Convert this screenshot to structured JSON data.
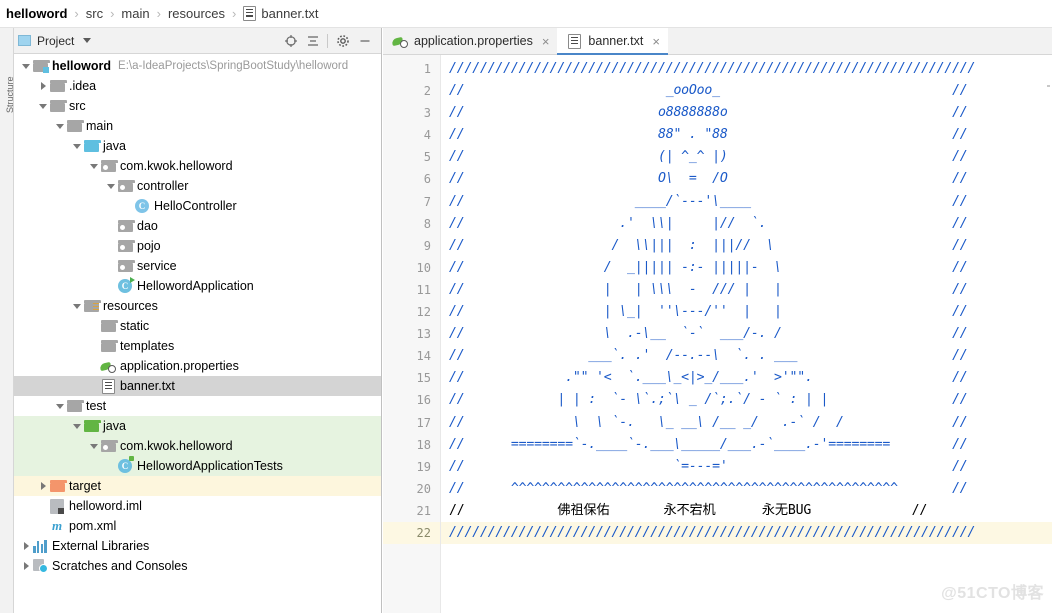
{
  "breadcrumb": {
    "items": [
      "helloword",
      "src",
      "main",
      "resources",
      "banner.txt"
    ],
    "separator": "›",
    "file_icon": "text-file-icon"
  },
  "left_strip": {
    "label": "Structure"
  },
  "project_panel": {
    "title": "Project",
    "caret_icon": "chevron-down-icon",
    "tools": [
      {
        "name": "locate-icon",
        "glyph": "⊕"
      },
      {
        "name": "collapse-all-icon",
        "glyph": "≡"
      },
      {
        "name": "settings-gear-icon",
        "glyph": "⚙"
      },
      {
        "name": "hide-panel-icon",
        "glyph": "—"
      }
    ],
    "tree": [
      {
        "label": "helloword",
        "hint": "E:\\a-IdeaProjects\\SpringBootStudy\\helloword",
        "indent": 0,
        "arrow": "open",
        "icon": "module-folder",
        "bold": true,
        "state": ""
      },
      {
        "label": ".idea",
        "hint": "",
        "indent": 1,
        "arrow": "closed",
        "icon": "folder-grey",
        "bold": false,
        "state": ""
      },
      {
        "label": "src",
        "hint": "",
        "indent": 1,
        "arrow": "open",
        "icon": "folder-grey",
        "bold": false,
        "state": ""
      },
      {
        "label": "main",
        "hint": "",
        "indent": 2,
        "arrow": "open",
        "icon": "folder-grey",
        "bold": false,
        "state": ""
      },
      {
        "label": "java",
        "hint": "",
        "indent": 3,
        "arrow": "open",
        "icon": "folder-blue",
        "bold": false,
        "state": ""
      },
      {
        "label": "com.kwok.helloword",
        "hint": "",
        "indent": 4,
        "arrow": "open",
        "icon": "package",
        "bold": false,
        "state": ""
      },
      {
        "label": "controller",
        "hint": "",
        "indent": 5,
        "arrow": "open",
        "icon": "package",
        "bold": false,
        "state": ""
      },
      {
        "label": "HelloController",
        "hint": "",
        "indent": 6,
        "arrow": "none",
        "icon": "class",
        "bold": false,
        "state": ""
      },
      {
        "label": "dao",
        "hint": "",
        "indent": 5,
        "arrow": "none",
        "icon": "package",
        "bold": false,
        "state": ""
      },
      {
        "label": "pojo",
        "hint": "",
        "indent": 5,
        "arrow": "none",
        "icon": "package",
        "bold": false,
        "state": ""
      },
      {
        "label": "service",
        "hint": "",
        "indent": 5,
        "arrow": "none",
        "icon": "package",
        "bold": false,
        "state": ""
      },
      {
        "label": "HellowordApplication",
        "hint": "",
        "indent": 5,
        "arrow": "none",
        "icon": "class-run",
        "bold": false,
        "state": ""
      },
      {
        "label": "resources",
        "hint": "",
        "indent": 3,
        "arrow": "open",
        "icon": "folder-resources",
        "bold": false,
        "state": ""
      },
      {
        "label": "static",
        "hint": "",
        "indent": 4,
        "arrow": "none",
        "icon": "folder-grey",
        "bold": false,
        "state": ""
      },
      {
        "label": "templates",
        "hint": "",
        "indent": 4,
        "arrow": "none",
        "icon": "folder-grey",
        "bold": false,
        "state": ""
      },
      {
        "label": "application.properties",
        "hint": "",
        "indent": 4,
        "arrow": "none",
        "icon": "properties",
        "bold": false,
        "state": ""
      },
      {
        "label": "banner.txt",
        "hint": "",
        "indent": 4,
        "arrow": "none",
        "icon": "text-file",
        "bold": false,
        "state": "sel"
      },
      {
        "label": "test",
        "hint": "",
        "indent": 2,
        "arrow": "open",
        "icon": "folder-grey",
        "bold": false,
        "state": ""
      },
      {
        "label": "java",
        "hint": "",
        "indent": 3,
        "arrow": "open",
        "icon": "folder-green",
        "bold": false,
        "state": "green"
      },
      {
        "label": "com.kwok.helloword",
        "hint": "",
        "indent": 4,
        "arrow": "open",
        "icon": "package",
        "bold": false,
        "state": "green"
      },
      {
        "label": "HellowordApplicationTests",
        "hint": "",
        "indent": 5,
        "arrow": "none",
        "icon": "class-test",
        "bold": false,
        "state": "green"
      },
      {
        "label": "target",
        "hint": "",
        "indent": 1,
        "arrow": "closed",
        "icon": "folder-orange",
        "bold": false,
        "state": "yellow"
      },
      {
        "label": "helloword.iml",
        "hint": "",
        "indent": 1,
        "arrow": "none",
        "icon": "iml",
        "bold": false,
        "state": ""
      },
      {
        "label": "pom.xml",
        "hint": "",
        "indent": 1,
        "arrow": "none",
        "icon": "maven",
        "bold": false,
        "state": ""
      },
      {
        "label": "External Libraries",
        "hint": "",
        "indent": 0,
        "arrow": "closed",
        "icon": "libraries",
        "bold": false,
        "state": ""
      },
      {
        "label": "Scratches and Consoles",
        "hint": "",
        "indent": 0,
        "arrow": "closed",
        "icon": "scratches",
        "bold": false,
        "state": ""
      }
    ]
  },
  "editor": {
    "tabs": [
      {
        "label": "application.properties",
        "icon": "properties-icon",
        "active": false,
        "close": "×"
      },
      {
        "label": "banner.txt",
        "icon": "text-file-icon",
        "active": true,
        "close": "×"
      }
    ],
    "active_tab_accent": "#4a86c8",
    "comment_color": "#1a59c8",
    "current_line_color": "#fdf8e3",
    "line_numbers": [
      1,
      2,
      3,
      4,
      5,
      6,
      7,
      8,
      9,
      10,
      11,
      12,
      13,
      14,
      15,
      16,
      17,
      18,
      19,
      20,
      21,
      22
    ],
    "current_line": 22,
    "lines": [
      "////////////////////////////////////////////////////////////////////",
      "//                          _ooOoo_                              //",
      "//                         o8888888o                             //",
      "//                         88\" . \"88                             //",
      "//                         (| ^_^ |)                             //",
      "//                         O\\  =  /O                             //",
      "//                      ____/`---'\\____                          //",
      "//                    .'  \\\\|     |//  `.                        //",
      "//                   /  \\\\|||  :  |||//  \\                       //",
      "//                  /  _||||| -:- |||||-  \\                      //",
      "//                  |   | \\\\\\  -  /// |   |                      //",
      "//                  | \\_|  ''\\---/''  |   |                      //",
      "//                  \\  .-\\__  `-`  ___/-. /                      //",
      "//                ___`. .'  /--.--\\  `. . ___                    //",
      "//             .\"\" '<  `.___\\_<|>_/___.'  >'\"\".                  //",
      "//            | | :  `- \\`.;`\\ _ /`;.`/ - ` : | |                //",
      "//              \\  \\ `-.   \\_ __\\ /__ _/   .-` /  /              //",
      "//      ========`-.____`-.___\\_____/___.-`____.-'========        //",
      "//                           `=---='                             //",
      "//      ^^^^^^^^^^^^^^^^^^^^^^^^^^^^^^^^^^^^^^^^^^^^^^^^^^       //",
      "//            佛祖保佑       永不宕机      永无BUG             //",
      "////////////////////////////////////////////////////////////////////"
    ],
    "cjk_lines": [
      21
    ]
  },
  "watermark": "@51CTO博客"
}
